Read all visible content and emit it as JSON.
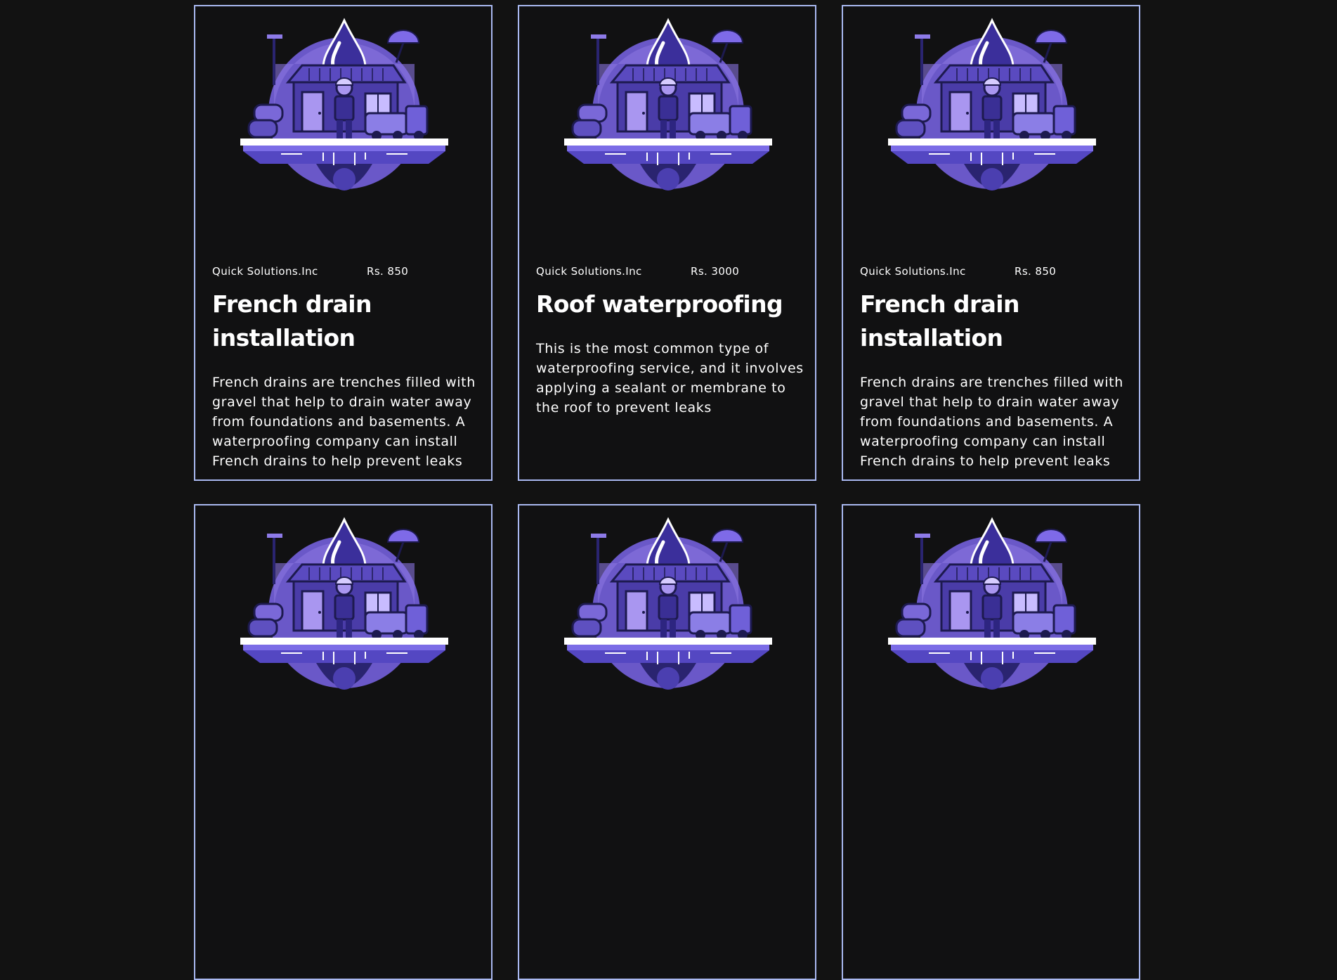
{
  "cards": [
    {
      "company": "Quick Solutions.Inc",
      "price": "Rs. 850",
      "title": "French drain installation",
      "description": "French drains are trenches filled with gravel that help to drain water away from foundations and basements. A waterproofing company can install French drains to help prevent leaks",
      "image_icon": "waterproofing-illustration"
    },
    {
      "company": "Quick Solutions.Inc",
      "price": "Rs. 3000",
      "title": "Roof waterproofing",
      "description": "This is the most common type of waterproofing service, and it involves applying a sealant or membrane to the roof to prevent leaks",
      "image_icon": "waterproofing-illustration"
    },
    {
      "company": "Quick Solutions.Inc",
      "price": "Rs. 850",
      "title": "French drain installation",
      "description": "French drains are trenches filled with gravel that help to drain water away from foundations and basements. A waterproofing company can install French drains to help prevent leaks",
      "image_icon": "waterproofing-illustration"
    },
    {
      "image_icon": "waterproofing-illustration"
    },
    {
      "image_icon": "waterproofing-illustration"
    },
    {
      "image_icon": "waterproofing-illustration"
    }
  ],
  "colors": {
    "background": "#121212",
    "card_border": "#a9b8f0",
    "illustration_primary": "#6b5fd3",
    "illustration_light": "#a996f0",
    "illustration_dark": "#1d1a4f"
  }
}
